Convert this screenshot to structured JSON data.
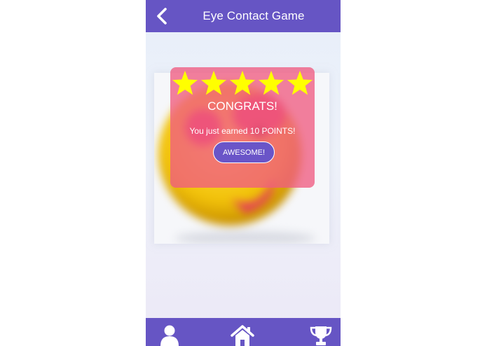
{
  "header": {
    "title": "Eye Contact Game",
    "back_icon": "chevron-left-icon"
  },
  "game": {
    "image_subject": "smiley-face-icon"
  },
  "modal": {
    "star_count": 5,
    "max_stars": 5,
    "heading": "CONGRATS!",
    "message": "You just earned 10 POINTS!",
    "button_label": "AWESOME!"
  },
  "bottom_nav": {
    "items": [
      {
        "icon": "user-icon"
      },
      {
        "icon": "home-icon"
      },
      {
        "icon": "trophy-icon"
      }
    ]
  },
  "colors": {
    "bar": "#6655c4",
    "modal": "#f05c82",
    "button": "#6a55c8",
    "star": "#ffff00"
  }
}
